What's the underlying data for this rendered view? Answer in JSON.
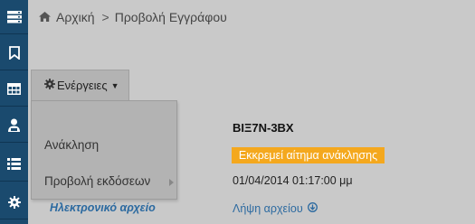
{
  "sidebar": {
    "items": [
      {
        "icon": "server-stack-icon"
      },
      {
        "icon": "bookmark-icon"
      },
      {
        "icon": "table-icon"
      },
      {
        "icon": "user-tie-icon"
      },
      {
        "icon": "list-icon"
      },
      {
        "icon": "gear-icon"
      }
    ]
  },
  "breadcrumb": {
    "home_label": "Αρχική",
    "separator": ">",
    "current": "Προβολή Εγγράφου"
  },
  "actions": {
    "label": "Ενέργειες",
    "menu": {
      "revoke": "Ανάκληση",
      "versions": "Προβολή εκδόσεων"
    }
  },
  "document": {
    "code": "ΒΙΞ7Ν-3ΒΧ",
    "status": "Εκκρεμεί αίτημα ανάκλησης",
    "date": "01/04/2014 01:17:00 μμ",
    "electronic_file_label": "Ηλεκτρονικό αρχείο",
    "download_label": "Λήψη αρχείου"
  },
  "colors": {
    "sidebar_bg": "#1a4a6e",
    "badge_bg": "#f4a81e",
    "link": "#2c6aa0"
  }
}
